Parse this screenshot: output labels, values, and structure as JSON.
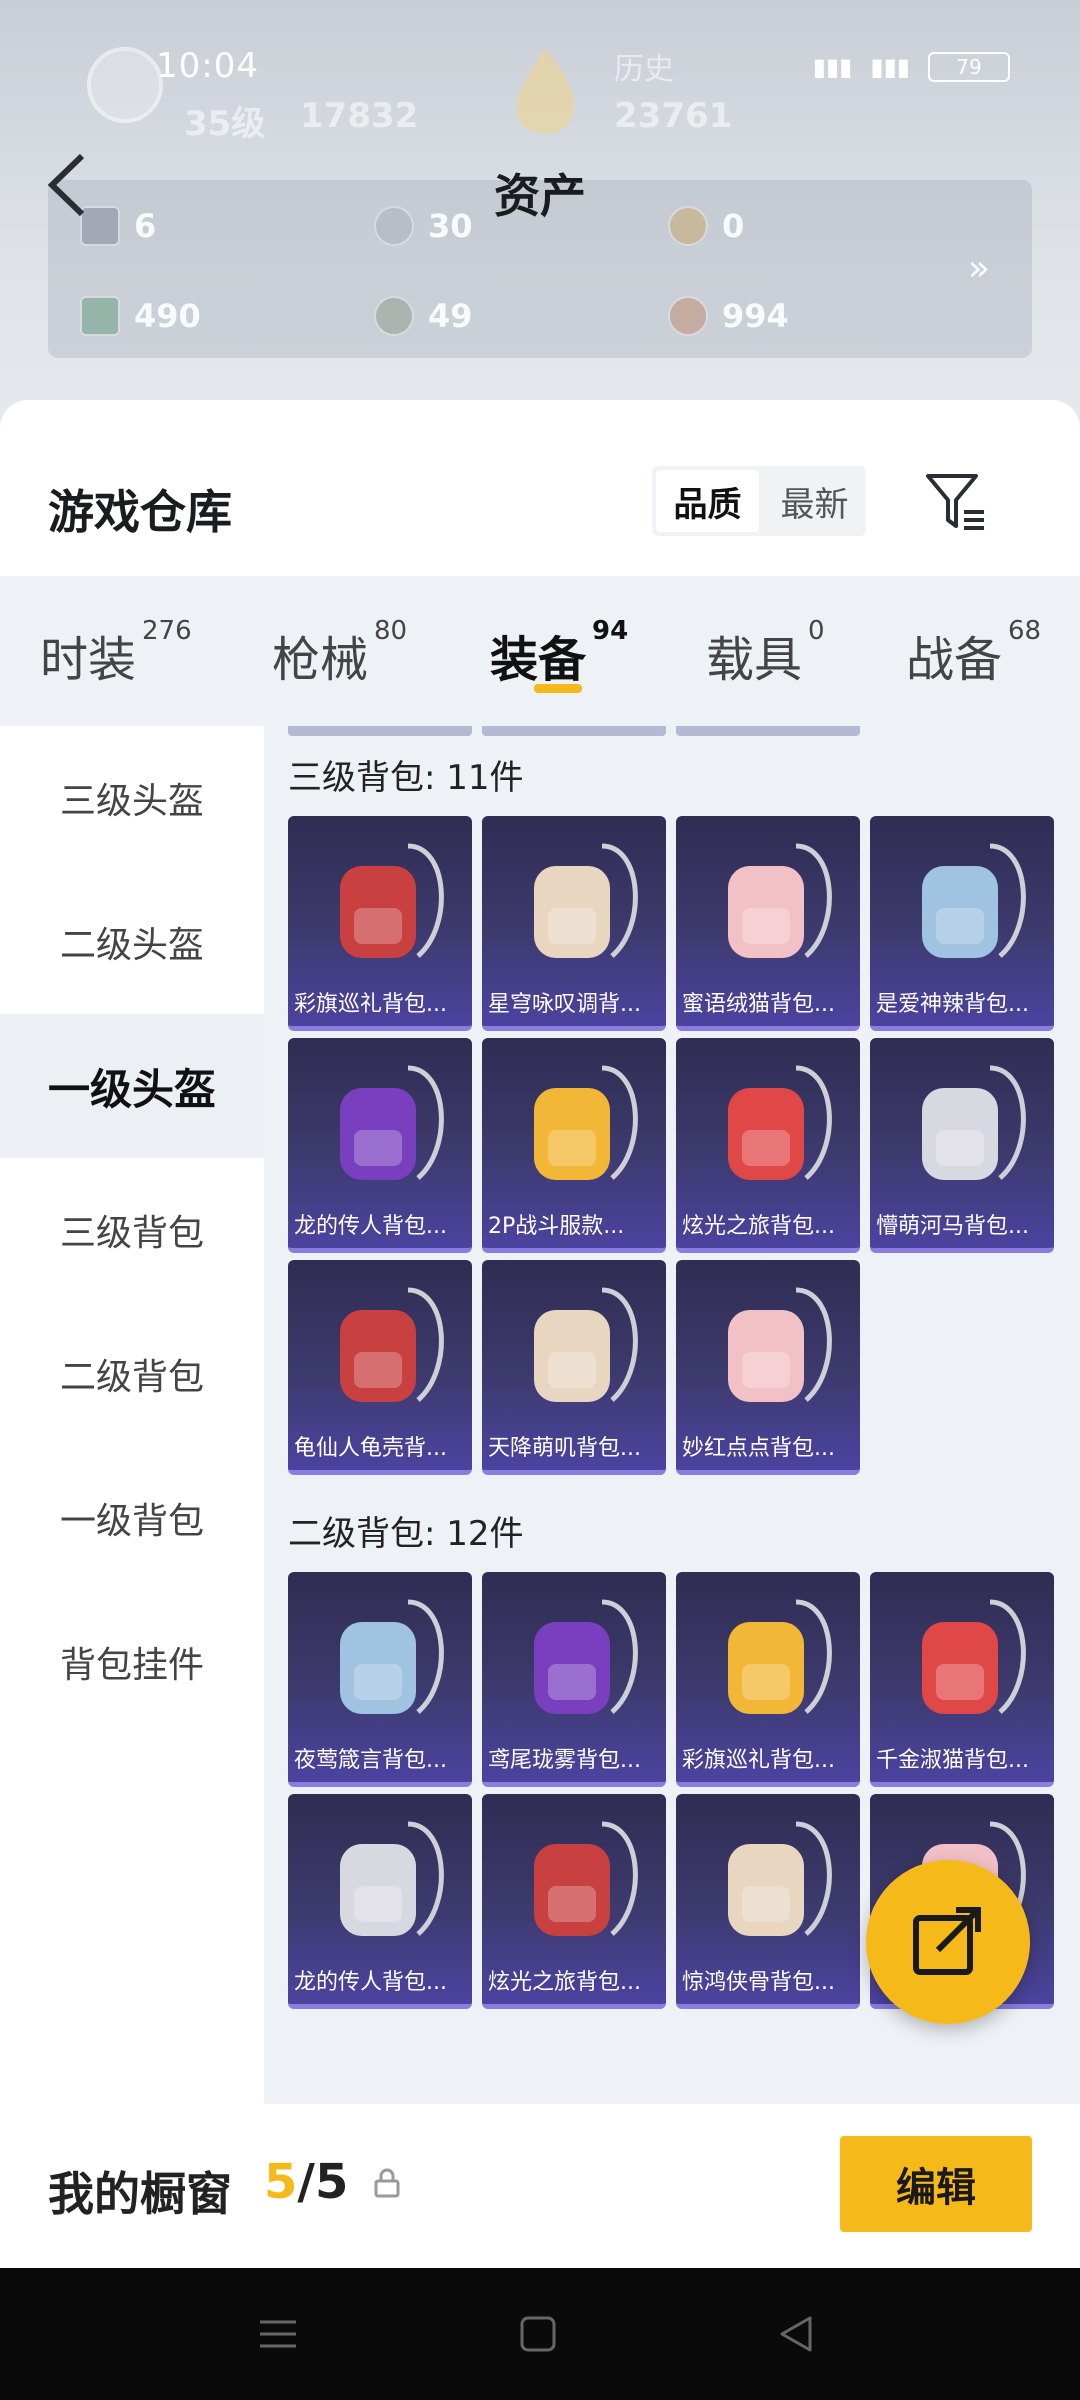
{
  "status_bar": {
    "time": "10:04",
    "battery": "79"
  },
  "header": {
    "title": "资产",
    "level": "35级",
    "rank_points": "17832",
    "history_label": "历史",
    "history_value": "23761",
    "assets": [
      {
        "icon": "card-icon",
        "value": "6"
      },
      {
        "icon": "silver-coin-icon",
        "value": "30"
      },
      {
        "icon": "gold-coin-icon",
        "value": "0"
      },
      {
        "icon": "ticket-icon",
        "value": "490"
      },
      {
        "icon": "gem-icon",
        "value": "49"
      },
      {
        "icon": "bronze-coin-icon",
        "value": "994"
      }
    ],
    "more": "»"
  },
  "warehouse": {
    "title": "游戏仓库",
    "sort_options": [
      "品质",
      "最新"
    ],
    "sort_active": "品质"
  },
  "tabs": [
    {
      "label": "时装",
      "count": "276"
    },
    {
      "label": "枪械",
      "count": "80"
    },
    {
      "label": "装备",
      "count": "94"
    },
    {
      "label": "载具",
      "count": "0"
    },
    {
      "label": "战备",
      "count": "68"
    }
  ],
  "sidebar": [
    "三级头盔",
    "二级头盔",
    "一级头盔",
    "三级背包",
    "二级背包",
    "一级背包",
    "背包挂件"
  ],
  "sidebar_active": "一级头盔",
  "sections": [
    {
      "label": "三级背包: 11件",
      "items": [
        "彩旗巡礼背包...",
        "星穹咏叹调背...",
        "蜜语绒猫背包...",
        "是爱神辣背包...",
        "龙的传人背包...",
        "2P战斗服款...",
        "炫光之旅背包...",
        "懵萌河马背包...",
        "龟仙人龟壳背...",
        "天降萌叽背包...",
        "妙红点点背包..."
      ]
    },
    {
      "label": "二级背包: 12件",
      "items": [
        "夜莺箴言背包...",
        "鸢尾珑雾背包...",
        "彩旗巡礼背包...",
        "千金淑猫背包...",
        "龙的传人背包...",
        "炫光之旅背包...",
        "惊鸿侠骨背包...",
        "..."
      ]
    }
  ],
  "showcase": {
    "title": "我的橱窗",
    "current": "5",
    "total": "/5",
    "edit": "编辑"
  },
  "colors": {
    "accent": "#f6b91a",
    "card_bg": "#3d3a6e"
  }
}
